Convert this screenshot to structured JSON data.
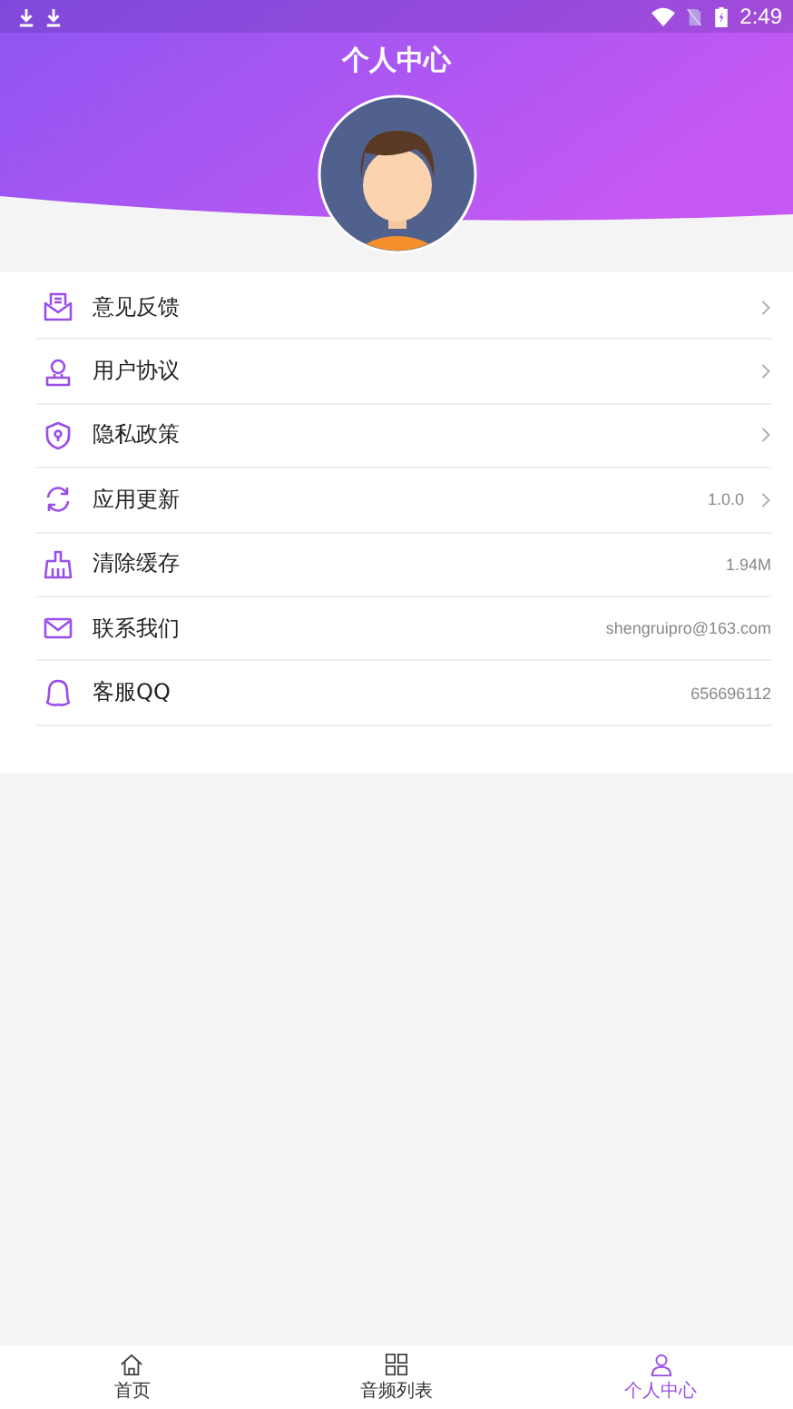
{
  "status_bar": {
    "time": "2:49"
  },
  "header": {
    "title": "个人中心"
  },
  "menu": [
    {
      "kind": "feedback",
      "label": "意见反馈",
      "chevron": true
    },
    {
      "kind": "agreement",
      "label": "用户协议",
      "chevron": true
    },
    {
      "kind": "privacy",
      "label": "隐私政策",
      "chevron": true
    },
    {
      "kind": "update",
      "label": "应用更新",
      "value": "1.0.0",
      "chevron": true
    },
    {
      "kind": "clear",
      "label": "清除缓存",
      "value": "1.94M",
      "chevron": false
    },
    {
      "kind": "contact",
      "label": "联系我们",
      "value": "shengruipro@163.com",
      "chevron": false
    },
    {
      "kind": "qq",
      "label": "客服QQ",
      "value": "656696112",
      "chevron": false
    }
  ],
  "tabs": [
    {
      "kind": "home",
      "label": "首页",
      "selected": false
    },
    {
      "kind": "list",
      "label": "音频列表",
      "selected": false
    },
    {
      "kind": "person",
      "label": "个人中心",
      "selected": true
    }
  ]
}
